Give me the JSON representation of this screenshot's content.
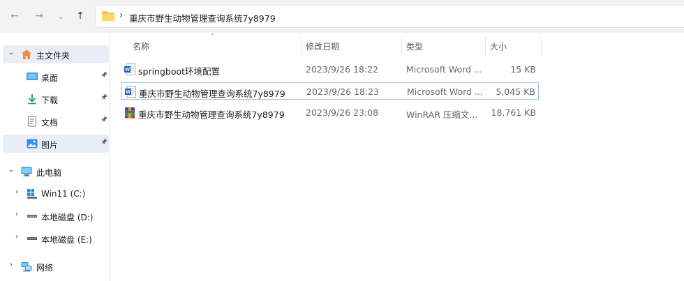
{
  "address": {
    "path": "重庆市野生动物管理查询系统7y8979",
    "separator": "›"
  },
  "nav_icons": {
    "back": "←",
    "forward": "→",
    "recent": "⌄",
    "up": "↑"
  },
  "sidebar": {
    "items": [
      {
        "label": "主文件夹",
        "chev": "⌄"
      },
      {
        "label": "桌面",
        "pin": "📌"
      },
      {
        "label": "下载",
        "pin": "📌"
      },
      {
        "label": "文档",
        "pin": "📌"
      },
      {
        "label": "图片",
        "pin": "📌"
      },
      {
        "label": "此电脑",
        "chev": "⌄"
      },
      {
        "label": "Win11 (C:)",
        "chev": "›"
      },
      {
        "label": "本地磁盘 (D:)",
        "chev": "›"
      },
      {
        "label": "本地磁盘 (E:)",
        "chev": "›"
      },
      {
        "label": "网络",
        "chev": "›"
      }
    ]
  },
  "columns": {
    "name": "名称",
    "date": "修改日期",
    "type": "类型",
    "size": "大小",
    "sort_indicator": "˄"
  },
  "files": [
    {
      "name": "springboot环境配置",
      "date": "2023/9/26 18:22",
      "type": "Microsoft Word ...",
      "size": "15 KB",
      "icon": "word-doc-icon"
    },
    {
      "name": "重庆市野生动物管理查询系统7y8979",
      "date": "2023/9/26 18:23",
      "type": "Microsoft Word ...",
      "size": "5,045 KB",
      "icon": "word-doc-icon"
    },
    {
      "name": "重庆市野生动物管理查询系统7y8979",
      "date": "2023/9/26 23:08",
      "type": "WinRAR 压缩文...",
      "size": "18,761 KB",
      "icon": "winrar-archive-icon"
    }
  ]
}
